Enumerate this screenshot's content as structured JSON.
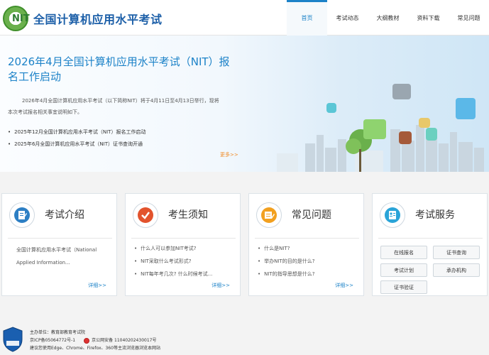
{
  "header": {
    "site_title": "全国计算机应用水平考试",
    "logo_text": "NIT",
    "nav": [
      {
        "label": "首页",
        "active": true
      },
      {
        "label": "考试动态",
        "active": false
      },
      {
        "label": "大纲教材",
        "active": false
      },
      {
        "label": "资料下载",
        "active": false
      },
      {
        "label": "常见问题",
        "active": false
      }
    ]
  },
  "banner": {
    "title": "2026年4月全国计算机应用水平考试（NIT）报名工作启动",
    "description": "2026年4月全国计算机应用水平考试（以下简称NIT）将于4月11日至4月13日举行，现将本次考试报名相关事宜说明如下。",
    "links": [
      "2025年12月全国计算机应用水平考试（NIT）报名工作启动",
      "2025年6月全国计算机应用水平考试（NIT）证书查询开通"
    ],
    "more_label": "更多>>"
  },
  "cards": {
    "intro": {
      "title": "考试介绍",
      "icon": "document-icon",
      "body": "全国计算机应用水平考试（National Applied Information...",
      "detail_label": "详细>>"
    },
    "notice": {
      "title": "考生须知",
      "icon": "checkmark-icon",
      "items": [
        "什么人可以参加NIT考试?",
        "NIT采取什么考试形式?",
        "NIT每年考几次? 什么时候考试..."
      ],
      "detail_label": "详细>>"
    },
    "faq": {
      "title": "常见问题",
      "icon": "pen-document-icon",
      "items": [
        "什么是NIT?",
        "举办NIT的目的是什么?",
        "NIT的指导思想是什么?"
      ],
      "detail_label": "详细>>"
    },
    "service": {
      "title": "考试服务",
      "icon": "id-card-icon",
      "buttons": [
        "在线报名",
        "证书查询",
        "考试计划",
        "承办机构",
        "证书验证"
      ]
    }
  },
  "footer": {
    "sponsor": "主办单位：教育部教育考试院",
    "icp": "京ICP备05064772号-1",
    "police": "京公网安备 11040202430017号",
    "browser_note": "建议您使用Edge、Chrome、Firefox、360等主流浏览器浏览本网站",
    "badge_text": "事业单位"
  },
  "colors": {
    "accent": "#1c82c8",
    "title_blue": "#1c5fa8",
    "more_orange": "#f08a24"
  }
}
